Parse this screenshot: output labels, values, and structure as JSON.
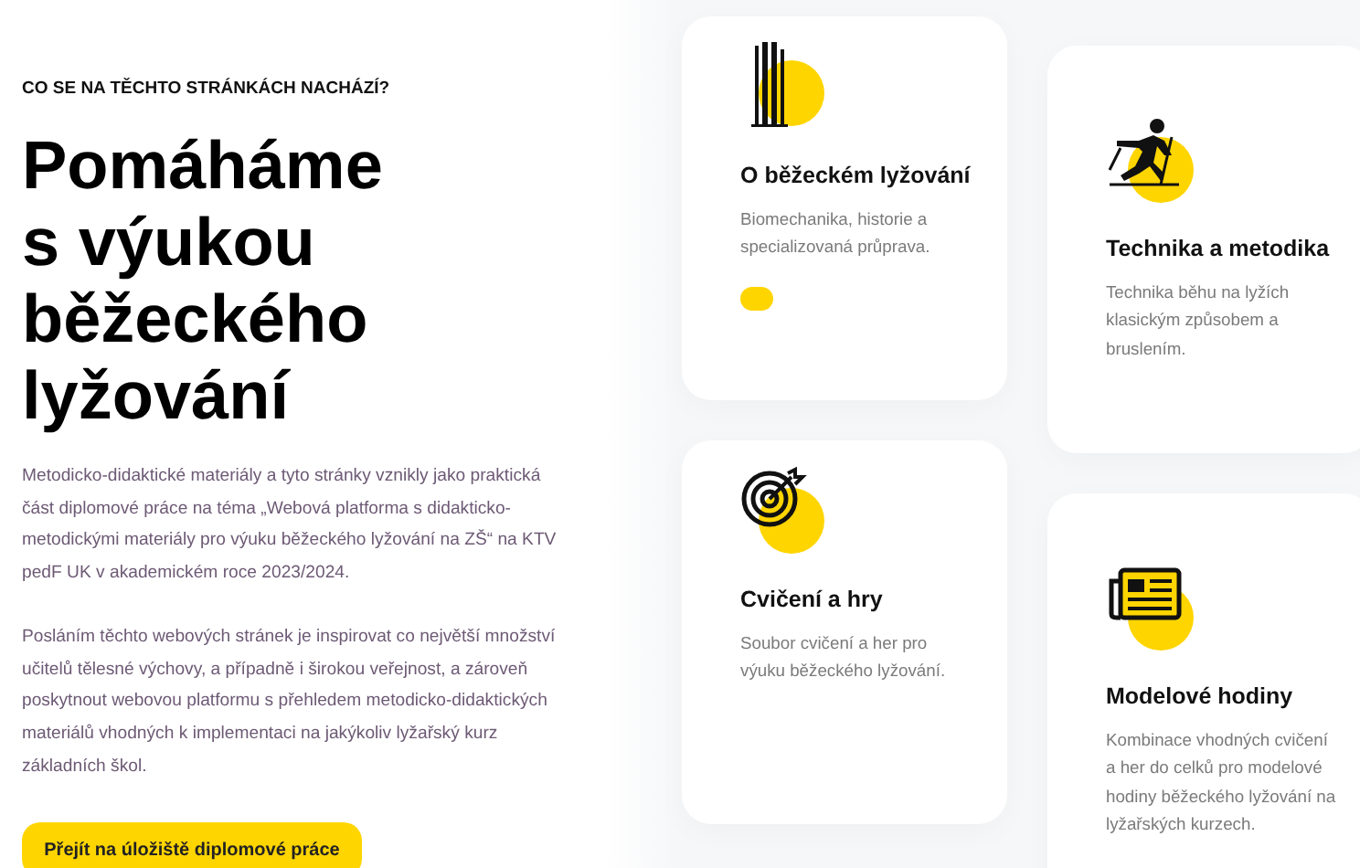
{
  "intro": {
    "eyebrow": "CO SE NA TĚCHTO STRÁNKÁCH NACHÁZÍ?",
    "heading": [
      "Pomáháme",
      "s výukou",
      "běžeckého",
      "lyžování"
    ],
    "paragraphs": [
      "Metodicko-didaktické materiály a tyto stránky vznikly jako praktická část diplomové práce na téma „Webová platforma s didakticko-metodickými materiály pro výuku běžeckého lyžování na ZŠ“ na KTV pedF UK v akademickém roce 2023/2024.",
      "Posláním těchto webových stránek je inspirovat co největší množství učitelů tělesné výchovy, a případně i širokou veřejnost, a zároveň poskytnout webovou platformu s přehledem metodicko-didaktických materiálů vhodných k implementaci na jakýkoliv lyžařský kurz základních škol."
    ],
    "button": "Přejít na úložiště diplomové práce"
  },
  "cards": [
    {
      "kind": "poles",
      "title": "O běžeckém lyžování",
      "text": "Biomechanika, historie a specializovaná průprava.",
      "selected": true
    },
    {
      "kind": "target",
      "title": "Cvičení a hry",
      "text": "Soubor cvičení a her pro výuku běžeckého lyžování.",
      "selected": false
    },
    {
      "kind": "skier",
      "title": "Technika a metodika",
      "text": "Technika běhu na lyžích klasickým způsobem a bruslením.",
      "selected": false
    },
    {
      "kind": "newspaper",
      "title": "Modelové hodiny",
      "text": "Kombinace vhodných cvičení a her do celků pro modelové hodiny běžeckého lyžování na lyžařských kurzech.",
      "selected": false
    }
  ]
}
